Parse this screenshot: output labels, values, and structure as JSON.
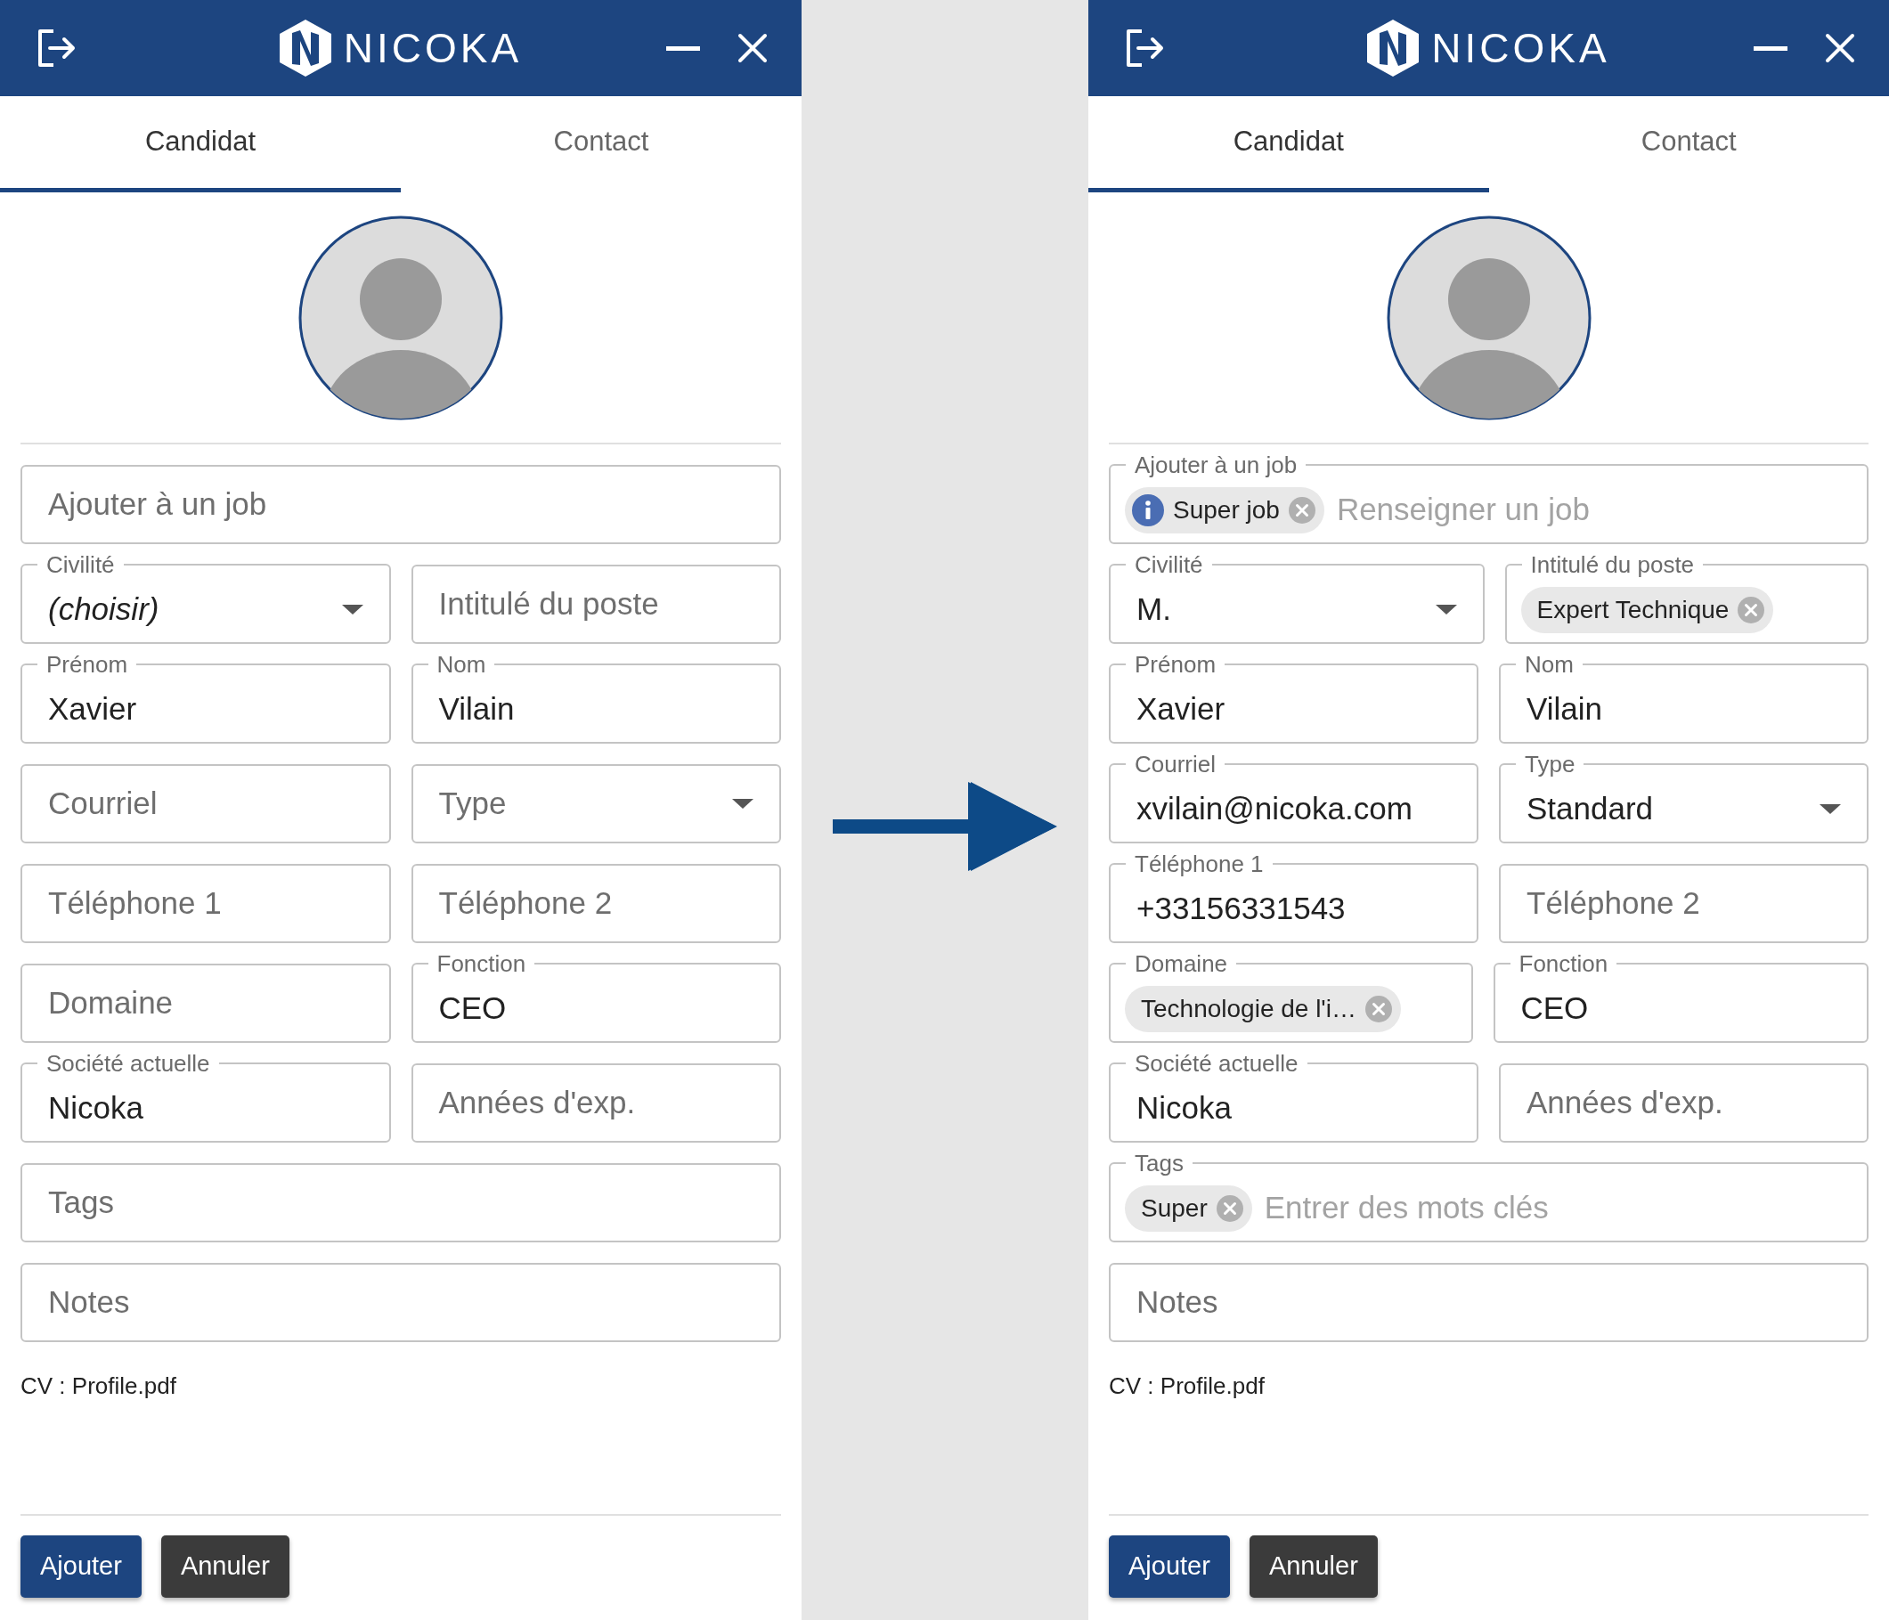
{
  "panels": [
    {
      "header": {
        "brand": "NICOKA"
      },
      "tabs": [
        {
          "label": "Candidat",
          "selected": true
        },
        {
          "label": "Contact",
          "selected": false
        }
      ],
      "rows": [
        [
          {
            "kind": "chips",
            "placeholder": "Ajouter à un job"
          }
        ],
        [
          {
            "kind": "select",
            "label": "Civilité",
            "value": "(choisir)",
            "is_default": true
          },
          {
            "kind": "text",
            "placeholder": "Intitulé du poste"
          }
        ],
        [
          {
            "kind": "text",
            "label": "Prénom",
            "value": "Xavier"
          },
          {
            "kind": "text",
            "label": "Nom",
            "value": "Vilain"
          }
        ],
        [
          {
            "kind": "text",
            "placeholder": "Courriel"
          },
          {
            "kind": "select",
            "placeholder": "Type"
          }
        ],
        [
          {
            "kind": "text",
            "placeholder": "Téléphone 1"
          },
          {
            "kind": "text",
            "placeholder": "Téléphone 2"
          }
        ],
        [
          {
            "kind": "text",
            "placeholder": "Domaine"
          },
          {
            "kind": "text",
            "label": "Fonction",
            "value": "CEO"
          }
        ],
        [
          {
            "kind": "text",
            "label": "Société actuelle",
            "value": "Nicoka"
          },
          {
            "kind": "text",
            "placeholder": "Années d'exp."
          }
        ],
        [
          {
            "kind": "text",
            "placeholder": "Tags"
          }
        ],
        [
          {
            "kind": "text",
            "placeholder": "Notes"
          }
        ]
      ],
      "cv": "CV : Profile.pdf",
      "buttons": [
        {
          "label": "Ajouter",
          "kind": "primary"
        },
        {
          "label": "Annuler",
          "kind": "secondary"
        }
      ]
    },
    {
      "header": {
        "brand": "NICOKA"
      },
      "tabs": [
        {
          "label": "Candidat",
          "selected": true
        },
        {
          "label": "Contact",
          "selected": false
        }
      ],
      "rows": [
        [
          {
            "kind": "chips",
            "label": "Ajouter à un job",
            "chips": [
              {
                "text": "Super job",
                "info": true
              }
            ],
            "placeholder": "Renseigner un job"
          }
        ],
        [
          {
            "kind": "select",
            "label": "Civilité",
            "value": "M.",
            "is_default": false
          },
          {
            "kind": "chips",
            "label": "Intitulé du poste",
            "chips": [
              {
                "text": "Expert Technique",
                "info": false
              }
            ]
          }
        ],
        [
          {
            "kind": "text",
            "label": "Prénom",
            "value": "Xavier"
          },
          {
            "kind": "text",
            "label": "Nom",
            "value": "Vilain"
          }
        ],
        [
          {
            "kind": "text",
            "label": "Courriel",
            "value": "xvilain@nicoka.com"
          },
          {
            "kind": "select",
            "label": "Type",
            "value": "Standard"
          }
        ],
        [
          {
            "kind": "text",
            "label": "Téléphone 1",
            "value": "+33156331543"
          },
          {
            "kind": "text",
            "placeholder": "Téléphone 2"
          }
        ],
        [
          {
            "kind": "chips",
            "label": "Domaine",
            "chips": [
              {
                "text": "Technologie de l'i…",
                "info": false
              }
            ]
          },
          {
            "kind": "text",
            "label": "Fonction",
            "value": "CEO"
          }
        ],
        [
          {
            "kind": "text",
            "label": "Société actuelle",
            "value": "Nicoka"
          },
          {
            "kind": "text",
            "placeholder": "Années d'exp."
          }
        ],
        [
          {
            "kind": "chips",
            "label": "Tags",
            "chips": [
              {
                "text": "Super",
                "info": false
              }
            ],
            "placeholder": "Entrer des mots clés"
          }
        ],
        [
          {
            "kind": "text",
            "placeholder": "Notes"
          }
        ]
      ],
      "cv": "CV : Profile.pdf",
      "buttons": [
        {
          "label": "Ajouter",
          "kind": "primary"
        },
        {
          "label": "Annuler",
          "kind": "secondary"
        }
      ]
    }
  ]
}
